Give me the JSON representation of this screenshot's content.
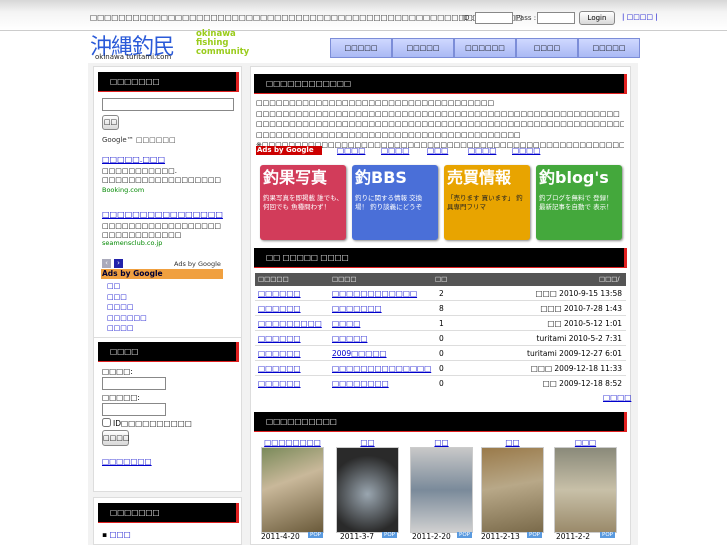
{
  "header": {
    "tagline": "□□□□□□□□□□□□□□□□□□□□□□□□□□□□□□□□□□□□□□□□□□□□□□□□□□□□□□□□□□□□□",
    "id_label": "ID :",
    "pass_label": "Pass :",
    "login_label": "Login",
    "help_label": "| □□□□ |"
  },
  "logo": {
    "kanji": "沖縄釣民",
    "url": "okinawa turitami.com",
    "en": [
      "okinawa",
      "fishing",
      "community"
    ]
  },
  "nav": [
    "□□□□□",
    "□□□□□",
    "□□□□□□",
    "□□□□",
    "□□□□□"
  ],
  "left": {
    "search_title": "□□□□□□□",
    "search_button": "□□",
    "google_label": "Google™ □□□□□□",
    "ads": [
      {
        "title": "□□□□□.□□□",
        "body": "□□□□□□□□□□□. □□□□□□□□□□□□□□□□□□",
        "url": "Booking.com"
      },
      {
        "title": "□□□□□□□□□□□□□□□□",
        "body": "□□□□□□□□□□□□□□□□□□ □□□□□□□□□□□□",
        "url": "seamensclub.co.jp"
      }
    ],
    "ads_by_google": "Ads by Google",
    "ads_google_small": "Ads by Google",
    "ads_links": [
      "□□",
      "□□□",
      "□□□□",
      "□□□□□□",
      "□□□□"
    ],
    "login_title": "□□□□",
    "user_label": "□□□□:",
    "pass_label": "□□□□□:",
    "remember_label": "ID□□□□□□□□□□",
    "login_button": "□□□□",
    "register_link": "□□□□□□□",
    "menu_title": "□□□□□□□",
    "menu_item": "□□□"
  },
  "main": {
    "intro_title": "□□□□□□□□□□□□",
    "intro_lines": [
      "□□□□□□□□□□□□□□□□□□□□□□□□□□□□□□□□□□□□",
      "□□□□□□□□□□□□□□□□□□□□□□□□□□□□□□□□□□□□□□□□□□□□□□□□□□□□□□□",
      "□□□□□□□□□□□□□□□□□□□□□□□□□□□□□□□□□□□□□□□□□□□□□□□□□□□□□□□□□□□",
      "□□□□□□□□□□□□□□□□□□□□□□□□□□□□□□□□□□□□□□□□",
      "※□□□□□□□□□□□□□□□□□□□□□□□□□□□□□□□□□□□□□□□□□□□□□□□□□□□□□□□□□□□□□□□□□"
    ],
    "ads_google_label": "Ads by Google",
    "ads_links": [
      "□□□□",
      "□□□□",
      "□□□",
      "□□□□",
      "□□□□"
    ],
    "banners": [
      {
        "title": "釣果写真",
        "sub": "釣果写真を即掲載 誰でも、何回でも 魚種問わず！",
        "color": "#d23c5a"
      },
      {
        "title": "釣BBS",
        "sub": "釣りに関する情報 交換場！ 釣り談義にどうぞ",
        "color": "#4a6fd8"
      },
      {
        "title": "売買情報",
        "sub": "「売ります 買います」 釣具専門フリマ",
        "color": "#e8a400"
      },
      {
        "title": "釣blog's",
        "sub": "釣ブログを無料で 登録！ 最新記事を自動で 表示！",
        "color": "#44a83c"
      }
    ],
    "bbs_title": "□□ □□□□□ □□□□",
    "table_headers": [
      "□□□□□",
      "□□□□",
      "□□",
      "□□□/□□"
    ],
    "table_rows": [
      {
        "cat": "□□□□□□",
        "topic": "□□□□□□□□□□□□",
        "count": "2",
        "date": "□□□ 2010-9-15 13:58"
      },
      {
        "cat": "□□□□□□",
        "topic": "□□□□□□□",
        "count": "8",
        "date": "□□□ 2010-7-28 1:43"
      },
      {
        "cat": "□□□□□□□□□",
        "topic": "□□□□",
        "count": "1",
        "date": "□□ 2010-5-12 1:01"
      },
      {
        "cat": "□□□□□□",
        "topic": "□□□□□",
        "count": "0",
        "date": "turitami 2010-5-2 7:31"
      },
      {
        "cat": "□□□□□□",
        "topic": "2009□□□□□",
        "count": "0",
        "date": "turitami 2009-12-27 6:01"
      },
      {
        "cat": "□□□□□□",
        "topic": "□□□□□□□□□□□□□□",
        "count": "0",
        "date": "□□□ 2009-12-18 11:33"
      },
      {
        "cat": "□□□□□□",
        "topic": "□□□□□□□□",
        "count": "0",
        "date": "□□ 2009-12-18 8:52"
      }
    ],
    "more_link": "□□□□",
    "photo_title": "□□□□□□□□□□",
    "photos": [
      {
        "title": "□□□□□□□□",
        "date": "2011-4-20",
        "badge": "POP"
      },
      {
        "title": "□□",
        "date": "2011-3-7",
        "badge": "POP"
      },
      {
        "title": "□□",
        "date": "2011-2-20",
        "badge": "POP"
      },
      {
        "title": "□□",
        "date": "2011-2-13",
        "badge": "POP"
      },
      {
        "title": "□□□",
        "date": "2011-2-2",
        "badge": "POP"
      }
    ]
  }
}
